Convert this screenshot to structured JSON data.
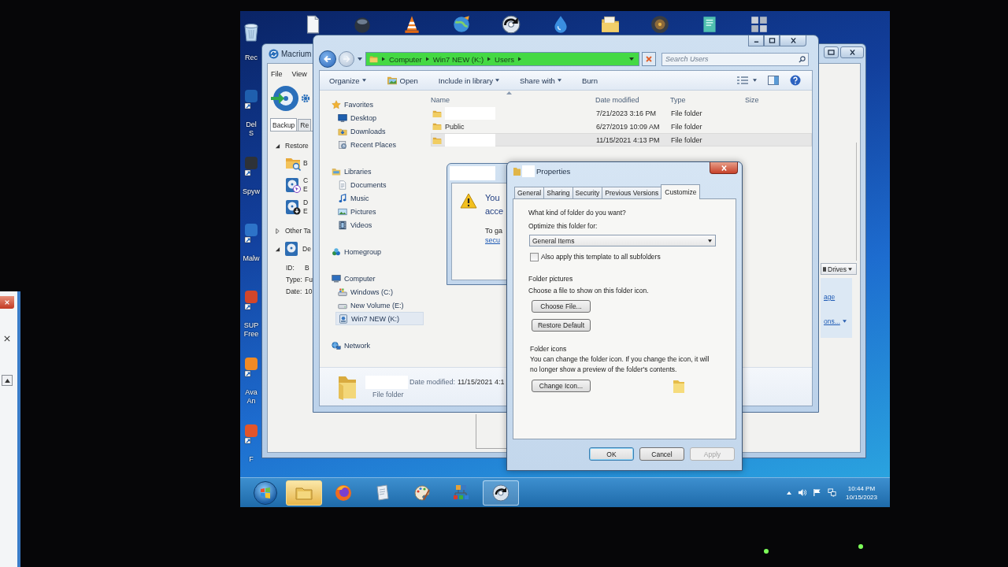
{
  "desktop": {
    "icons": [
      {
        "kind": "bin",
        "label_lines": [
          "Rec"
        ]
      },
      {
        "kind": "shortcut",
        "label_lines": [
          "Del",
          "S"
        ]
      },
      {
        "kind": "shortcut",
        "label_lines": [
          "Spyw"
        ]
      },
      {
        "kind": "shortcut",
        "label_lines": [
          "Malw"
        ]
      },
      {
        "kind": "shortcut",
        "label_lines": [
          "SUP",
          "Free"
        ]
      },
      {
        "kind": "shortcut",
        "label_lines": [
          "Ava",
          "An"
        ]
      },
      {
        "kind": "shortcut",
        "label_lines": [
          "F"
        ]
      }
    ]
  },
  "backup_window": {
    "title": "Macrium",
    "menu": [
      "File",
      "View"
    ],
    "tabs": [
      {
        "label": "Backup",
        "selected": true
      },
      {
        "label": "Re",
        "selected": false
      }
    ],
    "tree": [
      {
        "kind": "group",
        "label": "Restore",
        "expanded": true,
        "children": [
          {
            "kind": "folder",
            "lines": [
              "B"
            ]
          },
          {
            "kind": "pointer",
            "lines": [
              "C",
              "E"
            ]
          },
          {
            "kind": "download",
            "lines": [
              "D",
              "E"
            ]
          }
        ]
      },
      {
        "kind": "group",
        "label": "Other Ta",
        "expanded": false
      },
      {
        "kind": "disk",
        "label": "De",
        "expanded": true,
        "details": [
          {
            "label": "ID:",
            "value": "B"
          },
          {
            "label": "Type:",
            "value": "Fu"
          },
          {
            "label": "Date:",
            "value": "10"
          }
        ]
      }
    ],
    "drives_filter": "Drives",
    "links": [
      {
        "label": "age",
        "menu": false
      },
      {
        "label": "ons...",
        "menu": true
      }
    ]
  },
  "explorer_window": {
    "address": {
      "crumbs": [
        "Computer",
        "Win7 NEW (K:)",
        "Users"
      ],
      "level": 1
    },
    "search": {
      "placeholder": "Search Users"
    },
    "toolbar": [
      {
        "label": "Organize",
        "kind": "menu"
      },
      {
        "label": "Open",
        "kind": "open"
      },
      {
        "label": "Include in library",
        "kind": "menu"
      },
      {
        "label": "Share with",
        "kind": "menu"
      },
      {
        "label": "Burn",
        "kind": "plain"
      }
    ],
    "nav": [
      {
        "kind": "favorites",
        "label": "Favorites",
        "selected": false,
        "children": [
          {
            "kind": "desktop",
            "label": "Desktop",
            "selected": false
          },
          {
            "kind": "downloads",
            "label": "Downloads",
            "selected": false
          },
          {
            "kind": "places",
            "label": "Recent Places",
            "selected": false
          }
        ]
      },
      {
        "kind": "libraries",
        "label": "Libraries",
        "selected": false,
        "children": [
          {
            "kind": "documents",
            "label": "Documents",
            "selected": false
          },
          {
            "kind": "music",
            "label": "Music",
            "selected": false
          },
          {
            "kind": "pictures",
            "label": "Pictures",
            "selected": false
          },
          {
            "kind": "videos",
            "label": "Videos",
            "selected": false
          }
        ]
      },
      {
        "kind": "homegroup",
        "label": "Homegroup",
        "selected": false
      },
      {
        "kind": "computer",
        "label": "Computer",
        "selected": false,
        "children": [
          {
            "kind": "system",
            "label": "Windows (C:)",
            "selected": false
          },
          {
            "kind": "volume",
            "label": "New Volume (E:)",
            "selected": false
          },
          {
            "kind": "removable",
            "label": "Win7 NEW (K:)",
            "selected": true
          }
        ]
      },
      {
        "kind": "network",
        "label": "Network",
        "selected": false
      }
    ],
    "columns": [
      "Name",
      "Date modified",
      "Type",
      "Size"
    ],
    "rows": [
      {
        "redacted": true,
        "date": "7/21/2023 3:16 PM",
        "type": "File folder",
        "selected": false
      },
      {
        "redacted": false,
        "name": "Public",
        "date": "6/27/2019 10:09 AM",
        "type": "File folder",
        "selected": false
      },
      {
        "redacted": true,
        "date": "11/15/2021 4:13 PM",
        "type": "File folder",
        "selected": true
      }
    ],
    "details": {
      "redacted": true,
      "date_label": "Date modified:",
      "date_value": "11/15/2021 4:1",
      "type": "File folder"
    }
  },
  "error_dialog": {
    "title_redacted": true,
    "message_lines": [
      "You",
      "acce"
    ],
    "hint_lines": [
      "To ga"
    ],
    "link": "secu"
  },
  "properties_dialog": {
    "title_redacted": true,
    "title": "Properties",
    "tabs": [
      {
        "label": "General",
        "selected": false
      },
      {
        "label": "Sharing",
        "selected": false
      },
      {
        "label": "Security",
        "selected": false
      },
      {
        "label": "Previous Versions",
        "selected": false
      },
      {
        "label": "Customize",
        "selected": true
      }
    ],
    "question": "What kind of folder do you want?",
    "optimize_label": "Optimize this folder for:",
    "optimize_value": "General Items",
    "subfolders": {
      "label": "Also apply this template to all subfolders",
      "checked": false
    },
    "pictures_heading": "Folder pictures",
    "pictures_text": "Choose a file to show on this folder icon.",
    "pictures_buttons": [
      "Choose File...",
      "Restore Default"
    ],
    "icons_heading": "Folder icons",
    "icons_text": "You can change the folder icon. If you change the icon, it will no longer show a preview of the folder's contents.",
    "icons_button": "Change Icon...",
    "buttons": [
      {
        "label": "OK",
        "default": true,
        "disabled": false
      },
      {
        "label": "Cancel",
        "default": false,
        "disabled": false
      },
      {
        "label": "Apply",
        "default": false,
        "disabled": true
      }
    ]
  },
  "taskbar": {
    "buttons": [
      {
        "kind": "folder",
        "running": true,
        "active": true
      },
      {
        "kind": "browser",
        "running": false,
        "active": false
      },
      {
        "kind": "notes",
        "running": false,
        "active": false
      },
      {
        "kind": "paint",
        "running": false,
        "active": false
      },
      {
        "kind": "tiles",
        "running": false,
        "active": false
      },
      {
        "kind": "backup",
        "running": true,
        "active": false
      }
    ],
    "clock": {
      "time": "10:44 PM",
      "date": "10/15/2023"
    }
  }
}
